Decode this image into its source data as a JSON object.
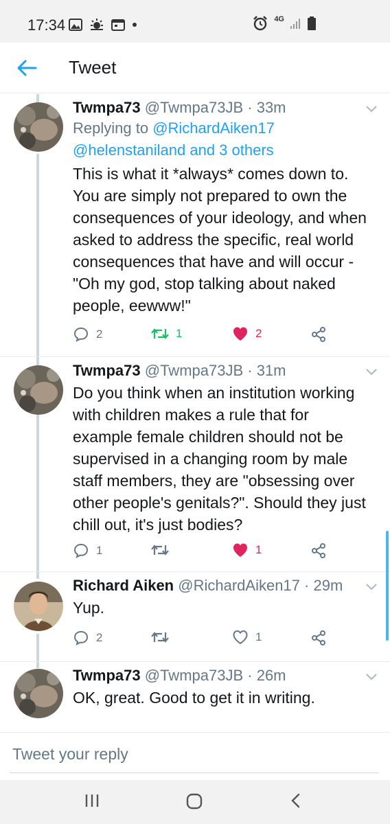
{
  "status_bar": {
    "time": "17:34",
    "network": "4G"
  },
  "header": {
    "title": "Tweet"
  },
  "tweets": [
    {
      "name": "Twmpa73",
      "handle": "@Twmpa73JB",
      "time": "· 33m",
      "replying_prefix": "Replying to",
      "replying_user1": "@RichardAiken17",
      "replying_user2": "@helenstaniland",
      "replying_suffix": "and 3 others",
      "text_lines": [
        "This is what it *always* comes down to.",
        "You are simply not prepared to own the",
        "consequences of your ideology, and when",
        "asked to address the specific, real world",
        "consequences that have and will occur -",
        "\"Oh my god, stop talking about naked",
        "people, eewww!\""
      ],
      "replies": "2",
      "retweets": "1",
      "likes": "2"
    },
    {
      "name": "Twmpa73",
      "handle": "@Twmpa73JB",
      "time": "· 31m",
      "text_lines": [
        "Do you think when an institution working",
        "with children makes a rule that for",
        "example female children should not be",
        "supervised in a changing room by male",
        "staff members, they are \"obsessing over",
        "other people's genitals?\". Should they just",
        "chill out, it's just bodies?"
      ],
      "replies": "1",
      "retweets": "",
      "likes": "1"
    },
    {
      "name": "Richard Aiken",
      "handle": "@RichardAiken17",
      "time": "· 29m",
      "text_lines": [
        "Yup."
      ],
      "replies": "2",
      "retweets": "",
      "likes": "1"
    },
    {
      "name": "Twmpa73",
      "handle": "@Twmpa73JB",
      "time": "· 26m",
      "text_lines": [
        "OK, great. Good to get it in writing."
      ]
    }
  ],
  "reply_bar": {
    "placeholder": "Tweet your reply"
  },
  "colors": {
    "accent": "#1da1f2",
    "like": "#e0245e",
    "retweet": "#17bf63",
    "secondary_text": "#657786"
  }
}
